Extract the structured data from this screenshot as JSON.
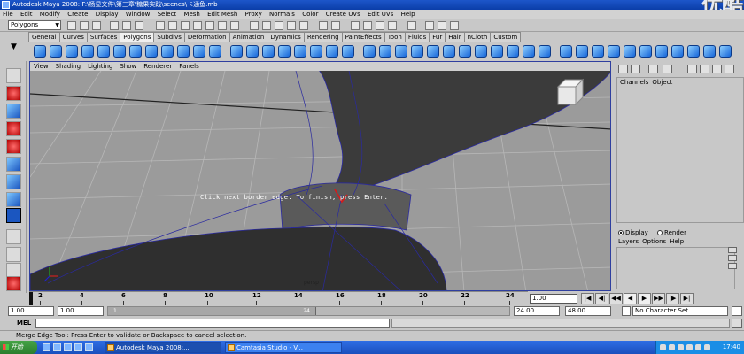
{
  "window": {
    "title": "Autodesk Maya 2008: F:\\杨显文件\\第三章\\糖果实践\\scenes\\卡通鱼.mb",
    "watermark": "优酷"
  },
  "menubar": [
    "File",
    "Edit",
    "Modify",
    "Create",
    "Display",
    "Window",
    "Select",
    "Mesh",
    "Edit Mesh",
    "Proxy",
    "Normals",
    "Color",
    "Create UVs",
    "Edit UVs",
    "Help"
  ],
  "mode_selector": "Polygons",
  "shelf_tabs": [
    "General",
    "Curves",
    "Surfaces",
    "Polygons",
    "Subdivs",
    "Deformation",
    "Animation",
    "Dynamics",
    "Rendering",
    "PaintEffects",
    "Toon",
    "Fluids",
    "Fur",
    "Hair",
    "nCloth",
    "Custom"
  ],
  "active_shelf_tab": "Polygons",
  "panel_menu": [
    "View",
    "Shading",
    "Lighting",
    "Show",
    "Renderer",
    "Panels"
  ],
  "viewport": {
    "tool_hint": "Click next border edge. To finish, press Enter.",
    "camera_label": "persp"
  },
  "channel_box": {
    "menu": [
      "Channels",
      "Object"
    ]
  },
  "layer_editor": {
    "display_label": "Display",
    "render_label": "Render",
    "menu": [
      "Layers",
      "Options",
      "Help"
    ]
  },
  "time_slider": {
    "ticks": [
      "2",
      "4",
      "6",
      "8",
      "10",
      "12",
      "14",
      "16",
      "18",
      "20",
      "22",
      "24"
    ],
    "current_frame": "1.00"
  },
  "range_slider": {
    "start_time": "1.00",
    "playback_start": "1.00",
    "handle_start": "1",
    "handle_end": "24",
    "playback_end": "24.00",
    "end_time": "48.00",
    "character_set": "No Character Set"
  },
  "command_line": {
    "label": "MEL"
  },
  "help_line": "Merge Edge Tool: Press Enter to validate or Backspace to cancel selection.",
  "taskbar": {
    "start": "开始",
    "tasks": [
      "Autodesk Maya 2008:...",
      "Camtasia Studio - V..."
    ],
    "clock": "17:40"
  }
}
